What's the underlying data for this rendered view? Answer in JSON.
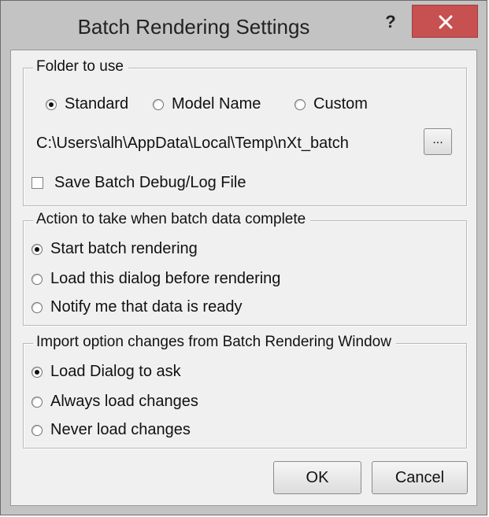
{
  "window": {
    "title": "Batch Rendering Settings",
    "help_label": "?",
    "close_label": "×"
  },
  "folder_group": {
    "legend": "Folder to use",
    "options": [
      {
        "label": "Standard",
        "checked": true
      },
      {
        "label": "Model Name",
        "checked": false
      },
      {
        "label": "Custom",
        "checked": false
      }
    ],
    "path": "C:\\Users\\alh\\AppData\\Local\\Temp\\nXt_batch",
    "browse_label": "...",
    "save_log_label": "Save Batch Debug/Log File",
    "save_log_checked": false
  },
  "action_group": {
    "legend": "Action to take when batch data complete",
    "options": [
      {
        "label": "Start batch rendering",
        "checked": true
      },
      {
        "label": "Load this dialog before rendering",
        "checked": false
      },
      {
        "label": "Notify me that data is ready",
        "checked": false
      }
    ]
  },
  "import_group": {
    "legend": "Import option changes from Batch Rendering Window",
    "options": [
      {
        "label": "Load Dialog to ask",
        "checked": true
      },
      {
        "label": "Always load changes",
        "checked": false
      },
      {
        "label": "Never load changes",
        "checked": false
      }
    ]
  },
  "buttons": {
    "ok": "OK",
    "cancel": "Cancel"
  },
  "colors": {
    "close_button": "#c75050",
    "frame": "#c3c3c3",
    "client": "#f0f0f0"
  }
}
